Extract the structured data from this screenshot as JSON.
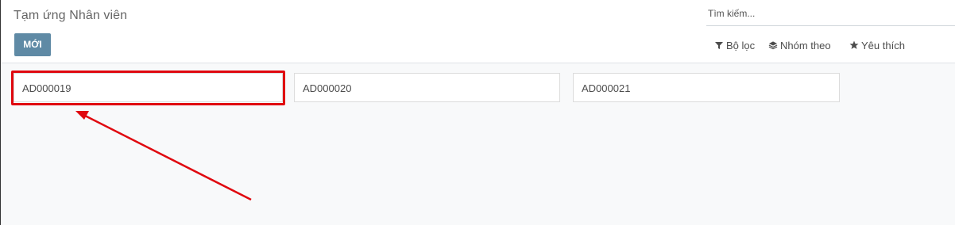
{
  "header": {
    "title": "Tạm ứng Nhân viên",
    "new_button_label": "MỚI"
  },
  "search": {
    "placeholder": "Tìm kiếm..."
  },
  "filters": {
    "filter_label": "Bộ lọc",
    "group_label": "Nhóm theo",
    "favorite_label": "Yêu thích"
  },
  "cards": [
    {
      "code": "AD000019"
    },
    {
      "code": "AD000020"
    },
    {
      "code": "AD000021"
    }
  ],
  "annotation": {
    "highlight_color": "#e0080f"
  }
}
